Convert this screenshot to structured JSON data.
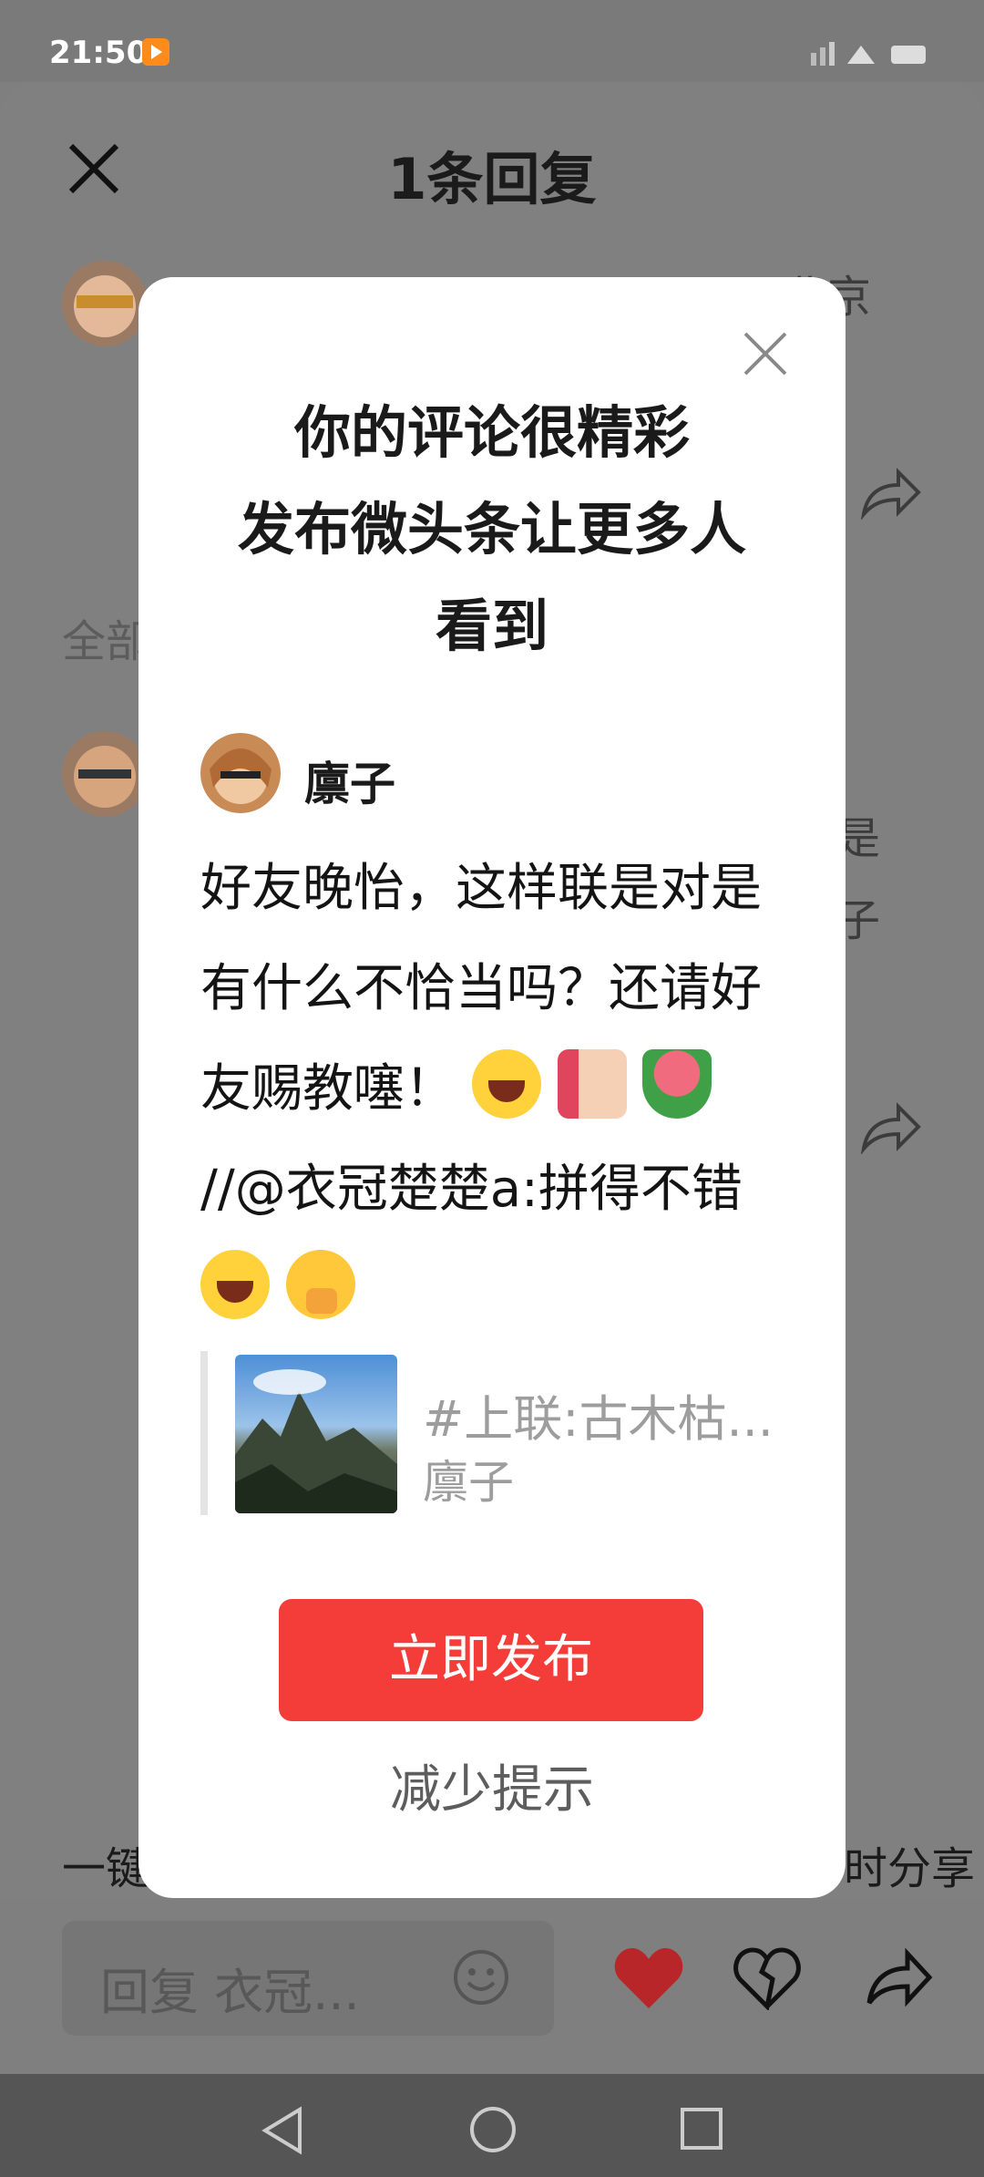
{
  "status_bar": {
    "time": "21:50"
  },
  "sheet": {
    "title": "1条回复",
    "background_fragments": {
      "comment_meta_tail": "北京",
      "section_label": "全部",
      "comment_tail_1": "是",
      "comment_tail_2": "子",
      "bottom_left": "一键",
      "bottom_right": "时分享"
    }
  },
  "reply_box": {
    "placeholder": "回复 衣冠..."
  },
  "modal": {
    "headline_line1": "你的评论很精彩",
    "headline_line2": "发布微头条让更多人",
    "headline_line3": "看到",
    "author_name": "廪子",
    "body_part1": "好友晚怡，这样联是对是有什么不恰当吗？还请好友赐教噻！",
    "body_part2": "//@衣冠楚楚a:拼得不错",
    "quote_title": "#上联:古木枯...",
    "quote_author": "廪子",
    "publish_label": "立即发布",
    "dismiss_label": "减少提示"
  },
  "colors": {
    "accent": "#f43d38",
    "overlay": "#808080",
    "heart": "#d9262b"
  }
}
